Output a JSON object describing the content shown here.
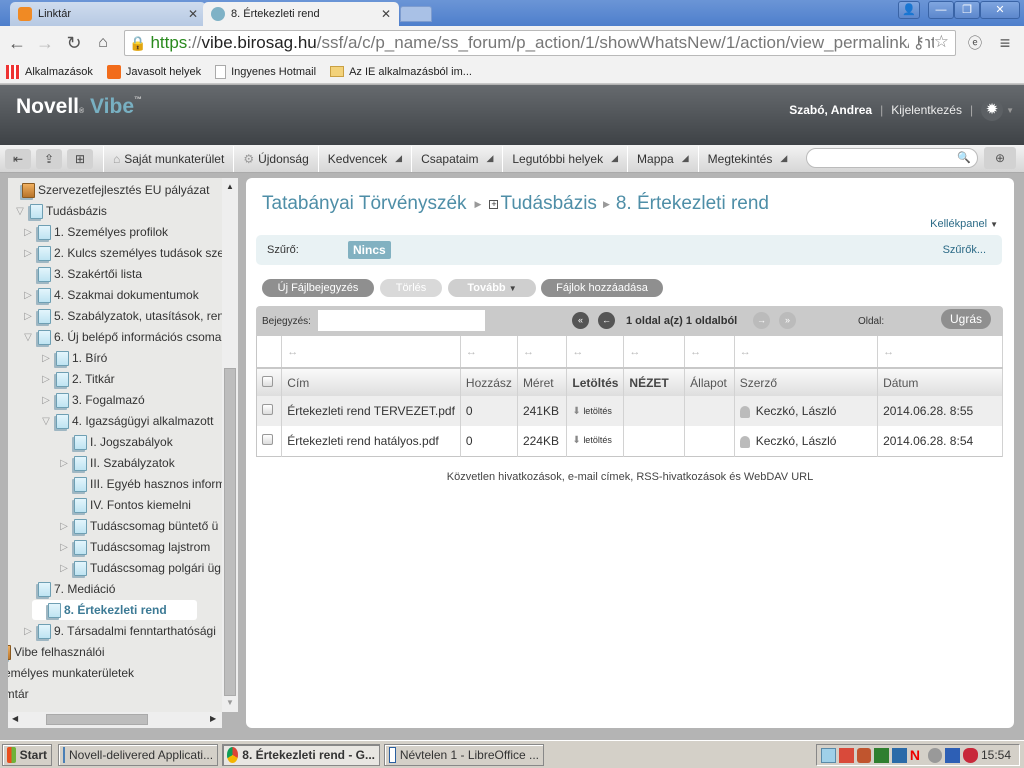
{
  "browser": {
    "tabs": [
      {
        "label": "Linktár",
        "active": false
      },
      {
        "label": "8. Értekezleti rend",
        "active": true
      }
    ],
    "url": {
      "scheme": "https",
      "host": "vibe.birosag.hu",
      "path": "/ssf/a/c/p_name/ss_forum/p_action/1/showWhatsNew/1/action/view_permalink/enti"
    },
    "bookmarks": [
      "Alkalmazások",
      "Javasolt helyek",
      "Ingyenes Hotmail",
      "Az IE alkalmazásból im..."
    ]
  },
  "vibe": {
    "logo": {
      "novell": "Novell",
      "vibe": "Vibe",
      "tm": "™"
    },
    "user": "Szabó, Andrea",
    "logout": "Kijelentkezés",
    "nav": {
      "items": [
        {
          "label": "Saját munkaterület",
          "icon": "home-icon",
          "has_menu": false
        },
        {
          "label": "Újdonság",
          "icon": "whats-new-icon",
          "has_menu": false
        },
        {
          "label": "Kedvencek",
          "has_menu": true
        },
        {
          "label": "Csapataim",
          "has_menu": true
        },
        {
          "label": "Legutóbbi helyek",
          "has_menu": true
        },
        {
          "label": "Mappa",
          "has_menu": true
        },
        {
          "label": "Megtekintés",
          "has_menu": true
        }
      ],
      "search_placeholder": ""
    }
  },
  "sidebar": {
    "items": [
      {
        "label": "Szervezetfejlesztés EU pályázat",
        "level": 0,
        "toggle": "",
        "icon": "workspace"
      },
      {
        "label": "Tudásbázis",
        "level": 0,
        "toggle": "open",
        "icon": "folder"
      },
      {
        "label": "1. Személyes profilok",
        "level": 1,
        "toggle": "closed",
        "icon": "folder"
      },
      {
        "label": "2. Kulcs személyes tudások sze",
        "level": 1,
        "toggle": "closed",
        "icon": "folder"
      },
      {
        "label": "3. Szakértői lista",
        "level": 1,
        "toggle": "",
        "icon": "folder"
      },
      {
        "label": "4. Szakmai dokumentumok",
        "level": 1,
        "toggle": "closed",
        "icon": "folder"
      },
      {
        "label": "5. Szabályzatok, utasítások, ren",
        "level": 1,
        "toggle": "closed",
        "icon": "folder"
      },
      {
        "label": "6. Új belépő információs csoma",
        "level": 1,
        "toggle": "open",
        "icon": "folder"
      },
      {
        "label": "1. Bíró",
        "level": 2,
        "toggle": "closed",
        "icon": "folder"
      },
      {
        "label": "2. Titkár",
        "level": 2,
        "toggle": "closed",
        "icon": "folder"
      },
      {
        "label": "3. Fogalmazó",
        "level": 2,
        "toggle": "closed",
        "icon": "folder"
      },
      {
        "label": "4. Igazságügyi alkalmazott",
        "level": 2,
        "toggle": "open",
        "icon": "folder"
      },
      {
        "label": "I. Jogszabályok",
        "level": 3,
        "toggle": "",
        "icon": "folder"
      },
      {
        "label": "II. Szabályzatok",
        "level": 3,
        "toggle": "closed",
        "icon": "folder"
      },
      {
        "label": "III. Egyéb hasznos inform",
        "level": 3,
        "toggle": "",
        "icon": "folder"
      },
      {
        "label": "IV. Fontos kiemelni",
        "level": 3,
        "toggle": "",
        "icon": "folder"
      },
      {
        "label": "Tudáscsomag büntető ü",
        "level": 3,
        "toggle": "closed",
        "icon": "folder"
      },
      {
        "label": "Tudáscsomag lajstrom",
        "level": 3,
        "toggle": "closed",
        "icon": "folder"
      },
      {
        "label": "Tudáscsomag polgári üg",
        "level": 3,
        "toggle": "closed",
        "icon": "folder"
      },
      {
        "label": "7. Mediáció",
        "level": 1,
        "toggle": "",
        "icon": "folder"
      },
      {
        "label": "8. Értekezleti rend",
        "level": 1,
        "toggle": "",
        "icon": "folder",
        "selected": true
      },
      {
        "label": "9. Társadalmi fenntarthatósági",
        "level": 1,
        "toggle": "closed",
        "icon": "folder"
      },
      {
        "label": "Vibe felhasználói",
        "level": -1,
        "toggle": "",
        "icon": "workspace"
      },
      {
        "label": "zemélyes munkaterületek",
        "level": -1,
        "toggle": "",
        "icon": ""
      },
      {
        "label": "omtár",
        "level": -1,
        "toggle": "",
        "icon": ""
      }
    ]
  },
  "main": {
    "breadcrumb": [
      "Tatabányai Törvényszék",
      "Tudásbázis",
      "8. Értekezleti rend"
    ],
    "kellekpanel": "Kellékpanel",
    "filter": {
      "label": "Szűrő:",
      "value": "Nincs",
      "link": "Szűrők..."
    },
    "actions": [
      "Új Fájlbejegyzés",
      "Törlés",
      "Tovább",
      "Fájlok hozzáadása"
    ],
    "pager": {
      "entry_label": "Bejegyzés:",
      "entry_value": "",
      "info": "1 oldal a(z) 1 oldalból",
      "page_label": "Oldal:",
      "page_value": "",
      "go": "Ugrás"
    },
    "table": {
      "columns": [
        "Cím",
        "Hozzász",
        "Méret",
        "Letöltés",
        "NÉZET",
        "Állapot",
        "Szerző",
        "Dátum"
      ],
      "rows": [
        {
          "title": "Értekezleti rend TERVEZET.pdf",
          "comments": "0",
          "size": "241KB",
          "download": "letöltés",
          "view": "",
          "status": "",
          "author": "Keczkó, László",
          "date": "2014.06.28. 8:55"
        },
        {
          "title": "Értekezleti rend hatályos.pdf",
          "comments": "0",
          "size": "224KB",
          "download": "letöltés",
          "view": "",
          "status": "",
          "author": "Keczkó, László",
          "date": "2014.06.28. 8:54"
        }
      ]
    },
    "footer_links": "Közvetlen hivatkozások, e-mail címek, RSS-hivatkozások és WebDAV URL"
  },
  "taskbar": {
    "start": "Start",
    "tasks": [
      "Novell-delivered Applicati...",
      "8. Értekezleti rend - G...",
      "Névtelen 1 - LibreOffice ..."
    ],
    "clock": "15:54"
  }
}
